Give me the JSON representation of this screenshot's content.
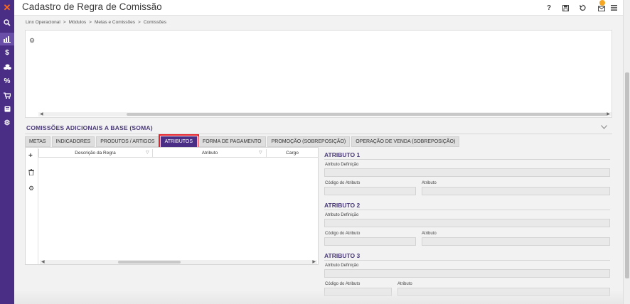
{
  "app": {
    "title": "Cadastro de Regra de Comissão"
  },
  "header": {
    "help_label": "?"
  },
  "breadcrumb": [
    "Linx Operacional",
    ">",
    "Módulos",
    ">",
    "Metas e Comissões",
    ">",
    "Comissões"
  ],
  "sidebar": {
    "icons": [
      "logo-icon",
      "search-icon",
      "chart-icon",
      "dollar-icon",
      "coins-icon",
      "percent-icon",
      "cart-icon",
      "book-icon",
      "gears-icon"
    ],
    "active_index": 2
  },
  "section": {
    "title": "COMISSÕES ADICIONAIS A BASE (SOMA)"
  },
  "tabs": [
    {
      "label": "METAS",
      "active": false
    },
    {
      "label": "INDICADORES",
      "active": false
    },
    {
      "label": "PRODUTOS / ARTIGOS",
      "active": false
    },
    {
      "label": "ATRIBUTOS",
      "active": true
    },
    {
      "label": "FORMA DE PAGAMENTO",
      "active": false
    },
    {
      "label": "PROMOÇÃO (SOBREPOSIÇÃO)",
      "active": false
    },
    {
      "label": "OPERAÇÃO DE VENDA (SOBREPOSIÇÃO)",
      "active": false
    }
  ],
  "grid": {
    "columns": [
      "Descrição da Regra",
      "Atributo",
      "Cargo"
    ],
    "rows": []
  },
  "form": {
    "sections": [
      {
        "title": "ATRIBUTO 1",
        "definition_label": "Atributo Definição",
        "code_label": "Código do Atributo",
        "attr_label": "Atributo"
      },
      {
        "title": "ATRIBUTO 2",
        "definition_label": "Atributo Definição",
        "code_label": "Código do Atributo",
        "attr_label": "Atributo"
      },
      {
        "title": "ATRIBUTO 3",
        "definition_label": "Atributo Definição",
        "code_label": "Código do Atributo",
        "attr_label": "Atributo"
      }
    ]
  },
  "colors": {
    "sidebar": "#4a2e85",
    "accent": "#4a3a78",
    "highlight": "#e8202a",
    "notification": "#f5a623"
  }
}
